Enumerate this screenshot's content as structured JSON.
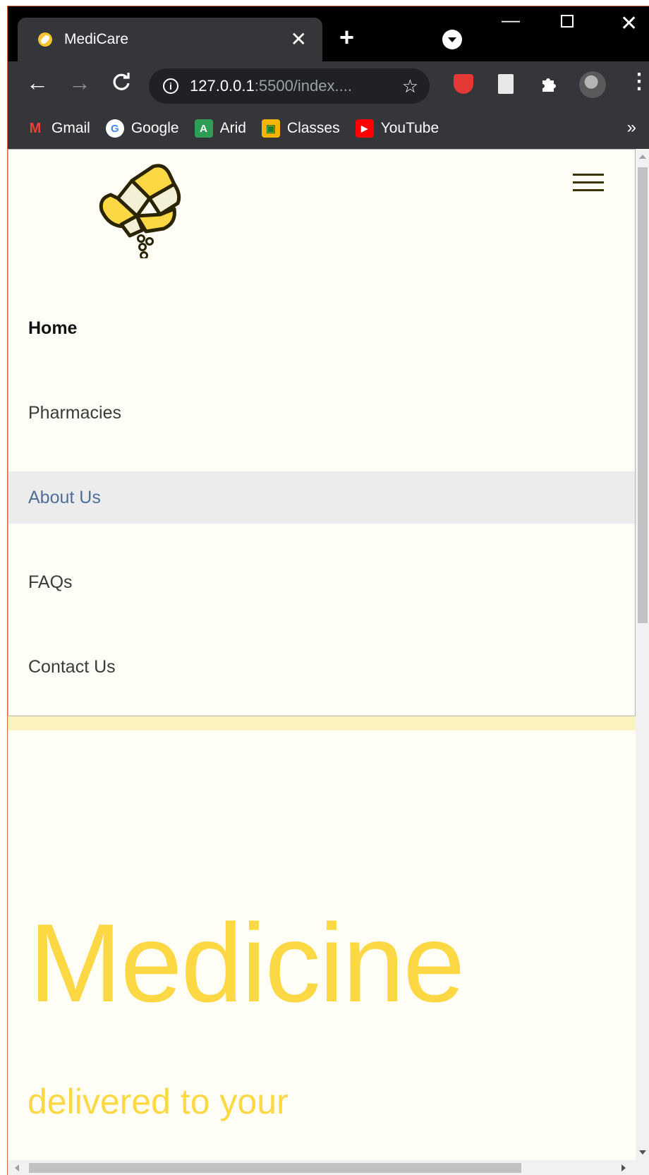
{
  "browser": {
    "tab_title": "MediCare",
    "tab_close": "✕",
    "new_tab": "+",
    "window_controls": {
      "minimize": "—",
      "close": "✕"
    },
    "nav": {
      "back": "←",
      "forward": "→",
      "reload": "C"
    },
    "url_host": "127.0.0.1",
    "url_rest": ":5500/index....",
    "info_icon": "i",
    "star": "☆",
    "menu": "⋮",
    "bookmarks": [
      {
        "label": "Gmail",
        "icon": "gmail-icon",
        "color": "#EA4335",
        "glyph": "M"
      },
      {
        "label": "Google",
        "icon": "google-icon",
        "color": "#4285F4",
        "glyph": "G"
      },
      {
        "label": "Arid",
        "icon": "arid-icon",
        "color": "#2e9e57",
        "glyph": "A"
      },
      {
        "label": "Classes",
        "icon": "classes-icon",
        "color": "#f4b400",
        "glyph": "▣"
      },
      {
        "label": "YouTube",
        "icon": "youtube-icon",
        "color": "#ff0000",
        "glyph": "▶"
      }
    ],
    "bookmarks_more": "»"
  },
  "page": {
    "nav_items": {
      "home": "Home",
      "pharmacies": "Pharmacies",
      "about": "About Us",
      "faqs": "FAQs",
      "contact": "Contact Us"
    },
    "hero": {
      "title": "Medicine",
      "subtitle": "delivered to your"
    }
  },
  "colors": {
    "page_bg": "#fefef7",
    "accent_yellow": "#fcd844",
    "hover_bg": "#ececec",
    "hover_text": "#4f6f99"
  }
}
